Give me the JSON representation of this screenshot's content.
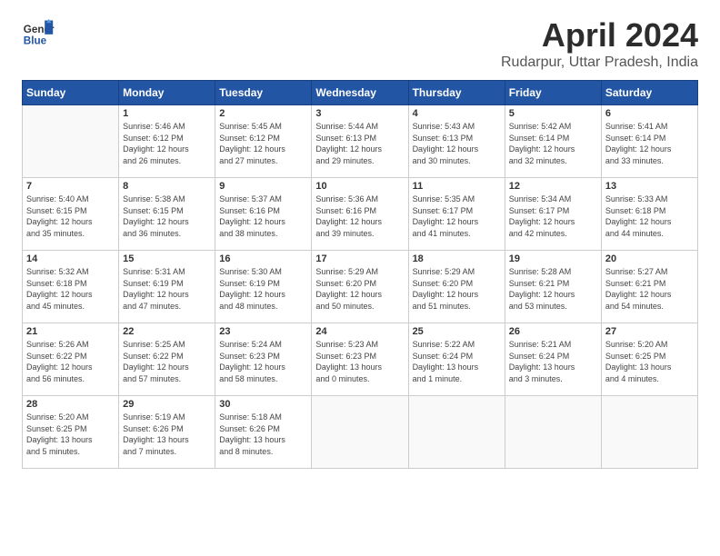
{
  "header": {
    "logo": {
      "general": "General",
      "blue": "Blue"
    },
    "title": "April 2024",
    "subtitle": "Rudarpur, Uttar Pradesh, India"
  },
  "weekdays": [
    "Sunday",
    "Monday",
    "Tuesday",
    "Wednesday",
    "Thursday",
    "Friday",
    "Saturday"
  ],
  "weeks": [
    [
      {
        "day": "",
        "info": ""
      },
      {
        "day": "1",
        "info": "Sunrise: 5:46 AM\nSunset: 6:12 PM\nDaylight: 12 hours\nand 26 minutes."
      },
      {
        "day": "2",
        "info": "Sunrise: 5:45 AM\nSunset: 6:12 PM\nDaylight: 12 hours\nand 27 minutes."
      },
      {
        "day": "3",
        "info": "Sunrise: 5:44 AM\nSunset: 6:13 PM\nDaylight: 12 hours\nand 29 minutes."
      },
      {
        "day": "4",
        "info": "Sunrise: 5:43 AM\nSunset: 6:13 PM\nDaylight: 12 hours\nand 30 minutes."
      },
      {
        "day": "5",
        "info": "Sunrise: 5:42 AM\nSunset: 6:14 PM\nDaylight: 12 hours\nand 32 minutes."
      },
      {
        "day": "6",
        "info": "Sunrise: 5:41 AM\nSunset: 6:14 PM\nDaylight: 12 hours\nand 33 minutes."
      }
    ],
    [
      {
        "day": "7",
        "info": "Sunrise: 5:40 AM\nSunset: 6:15 PM\nDaylight: 12 hours\nand 35 minutes."
      },
      {
        "day": "8",
        "info": "Sunrise: 5:38 AM\nSunset: 6:15 PM\nDaylight: 12 hours\nand 36 minutes."
      },
      {
        "day": "9",
        "info": "Sunrise: 5:37 AM\nSunset: 6:16 PM\nDaylight: 12 hours\nand 38 minutes."
      },
      {
        "day": "10",
        "info": "Sunrise: 5:36 AM\nSunset: 6:16 PM\nDaylight: 12 hours\nand 39 minutes."
      },
      {
        "day": "11",
        "info": "Sunrise: 5:35 AM\nSunset: 6:17 PM\nDaylight: 12 hours\nand 41 minutes."
      },
      {
        "day": "12",
        "info": "Sunrise: 5:34 AM\nSunset: 6:17 PM\nDaylight: 12 hours\nand 42 minutes."
      },
      {
        "day": "13",
        "info": "Sunrise: 5:33 AM\nSunset: 6:18 PM\nDaylight: 12 hours\nand 44 minutes."
      }
    ],
    [
      {
        "day": "14",
        "info": "Sunrise: 5:32 AM\nSunset: 6:18 PM\nDaylight: 12 hours\nand 45 minutes."
      },
      {
        "day": "15",
        "info": "Sunrise: 5:31 AM\nSunset: 6:19 PM\nDaylight: 12 hours\nand 47 minutes."
      },
      {
        "day": "16",
        "info": "Sunrise: 5:30 AM\nSunset: 6:19 PM\nDaylight: 12 hours\nand 48 minutes."
      },
      {
        "day": "17",
        "info": "Sunrise: 5:29 AM\nSunset: 6:20 PM\nDaylight: 12 hours\nand 50 minutes."
      },
      {
        "day": "18",
        "info": "Sunrise: 5:29 AM\nSunset: 6:20 PM\nDaylight: 12 hours\nand 51 minutes."
      },
      {
        "day": "19",
        "info": "Sunrise: 5:28 AM\nSunset: 6:21 PM\nDaylight: 12 hours\nand 53 minutes."
      },
      {
        "day": "20",
        "info": "Sunrise: 5:27 AM\nSunset: 6:21 PM\nDaylight: 12 hours\nand 54 minutes."
      }
    ],
    [
      {
        "day": "21",
        "info": "Sunrise: 5:26 AM\nSunset: 6:22 PM\nDaylight: 12 hours\nand 56 minutes."
      },
      {
        "day": "22",
        "info": "Sunrise: 5:25 AM\nSunset: 6:22 PM\nDaylight: 12 hours\nand 57 minutes."
      },
      {
        "day": "23",
        "info": "Sunrise: 5:24 AM\nSunset: 6:23 PM\nDaylight: 12 hours\nand 58 minutes."
      },
      {
        "day": "24",
        "info": "Sunrise: 5:23 AM\nSunset: 6:23 PM\nDaylight: 13 hours\nand 0 minutes."
      },
      {
        "day": "25",
        "info": "Sunrise: 5:22 AM\nSunset: 6:24 PM\nDaylight: 13 hours\nand 1 minute."
      },
      {
        "day": "26",
        "info": "Sunrise: 5:21 AM\nSunset: 6:24 PM\nDaylight: 13 hours\nand 3 minutes."
      },
      {
        "day": "27",
        "info": "Sunrise: 5:20 AM\nSunset: 6:25 PM\nDaylight: 13 hours\nand 4 minutes."
      }
    ],
    [
      {
        "day": "28",
        "info": "Sunrise: 5:20 AM\nSunset: 6:25 PM\nDaylight: 13 hours\nand 5 minutes."
      },
      {
        "day": "29",
        "info": "Sunrise: 5:19 AM\nSunset: 6:26 PM\nDaylight: 13 hours\nand 7 minutes."
      },
      {
        "day": "30",
        "info": "Sunrise: 5:18 AM\nSunset: 6:26 PM\nDaylight: 13 hours\nand 8 minutes."
      },
      {
        "day": "",
        "info": ""
      },
      {
        "day": "",
        "info": ""
      },
      {
        "day": "",
        "info": ""
      },
      {
        "day": "",
        "info": ""
      }
    ]
  ]
}
